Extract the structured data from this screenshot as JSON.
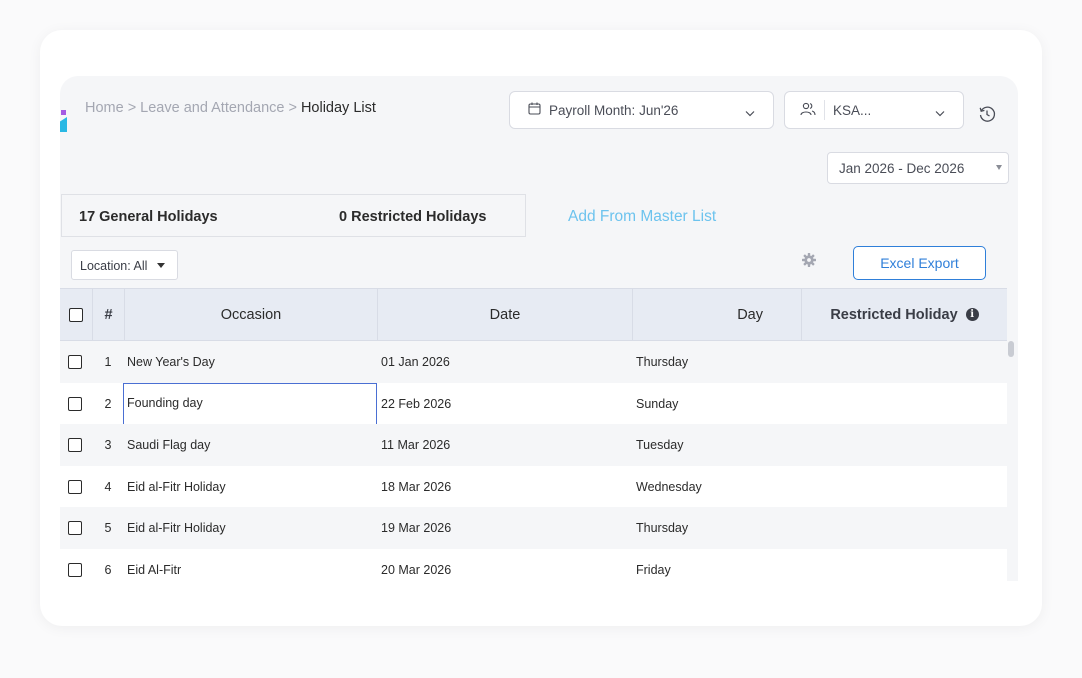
{
  "breadcrumb": {
    "home": "Home",
    "sep1": ">",
    "section": "Leave and Attendance",
    "sep2": ">",
    "current": "Holiday List"
  },
  "payroll_month": {
    "label": "Payroll Month:",
    "value": "Jun'26"
  },
  "region_select": {
    "value": "KSA..."
  },
  "date_range": {
    "value": "Jan 2026 - Dec 2026"
  },
  "tabs": {
    "general": "17 General Holidays",
    "restricted": "0 Restricted Holidays"
  },
  "add_from_master": "Add From Master List",
  "location_filter": {
    "label": "Location: All"
  },
  "excel_export": "Excel Export",
  "table": {
    "headers": {
      "num": "#",
      "occasion": "Occasion",
      "date": "Date",
      "day": "Day",
      "restricted": "Restricted Holiday"
    },
    "rows": [
      {
        "num": "1",
        "occasion": "New Year's Day",
        "date": "01 Jan 2026",
        "day": "Thursday"
      },
      {
        "num": "2",
        "occasion": "Founding day",
        "date": "22 Feb 2026",
        "day": "Sunday"
      },
      {
        "num": "3",
        "occasion": "Saudi Flag day",
        "date": "11 Mar 2026",
        "day": "Tuesday"
      },
      {
        "num": "4",
        "occasion": "Eid al-Fitr Holiday",
        "date": "18 Mar 2026",
        "day": "Wednesday"
      },
      {
        "num": "5",
        "occasion": "Eid al-Fitr Holiday",
        "date": "19 Mar 2026",
        "day": "Thursday"
      },
      {
        "num": "6",
        "occasion": "Eid Al-Fitr",
        "date": "20 Mar 2026",
        "day": "Friday"
      }
    ]
  },
  "colors": {
    "accent": "#2f7fd9",
    "link": "#6cc3ee",
    "header_bg": "#e7ebf3",
    "focus_border": "#4a6fd3"
  }
}
